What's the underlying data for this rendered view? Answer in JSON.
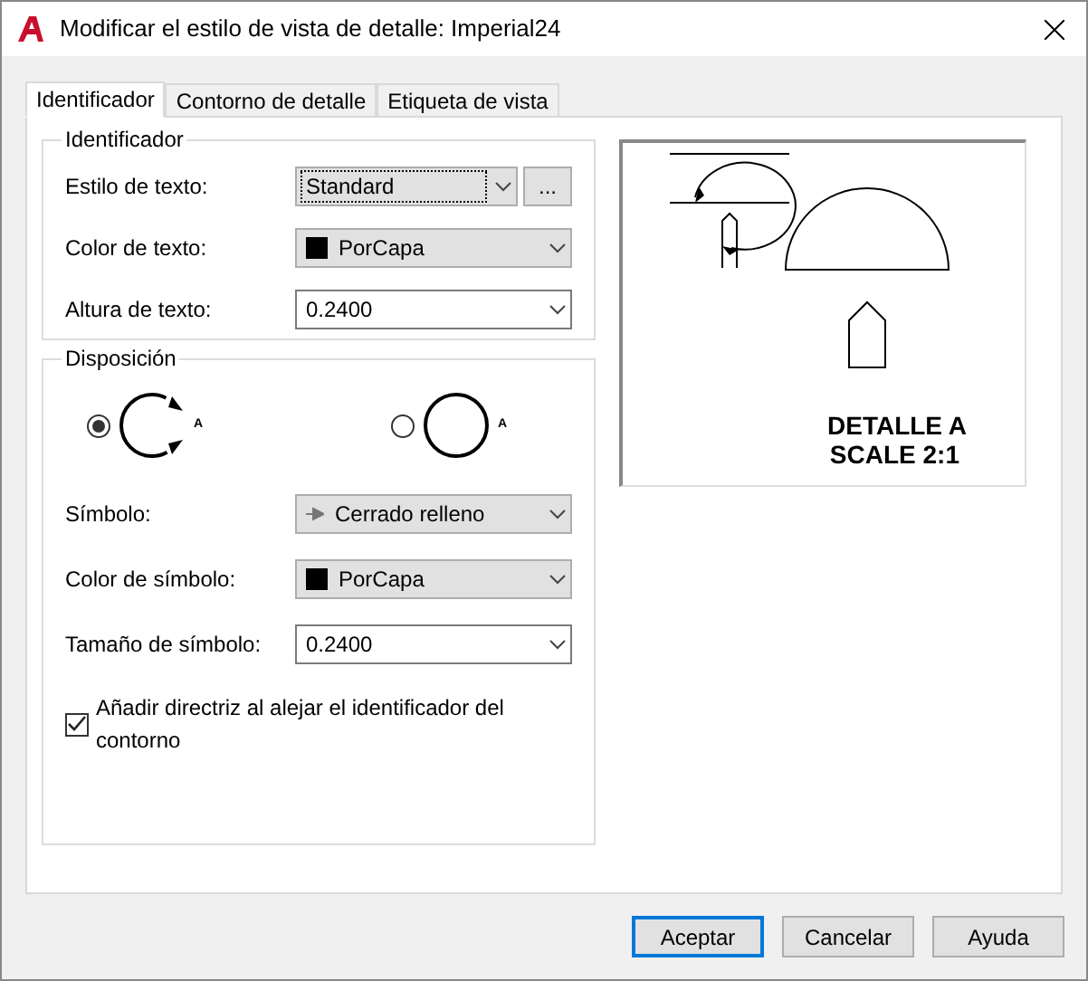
{
  "window": {
    "title": "Modificar el estilo de vista de detalle: Imperial24"
  },
  "tabs": [
    {
      "label": "Identificador",
      "selected": true
    },
    {
      "label": "Contorno de detalle",
      "selected": false
    },
    {
      "label": "Etiqueta de vista",
      "selected": false
    }
  ],
  "identifier_group": {
    "title": "Identificador",
    "fields": [
      {
        "kind": "combo",
        "label": "Estilo de texto:",
        "value": "Standard",
        "focused": true,
        "button": "..."
      },
      {
        "kind": "color",
        "label": "Color de texto:",
        "value": "PorCapa",
        "focused": false
      },
      {
        "kind": "edit",
        "label": "Altura de texto:",
        "value": "0.2400",
        "focused": false
      }
    ]
  },
  "layout_group": {
    "title": "Disposición",
    "options": [
      {
        "selected": true,
        "label": "A"
      },
      {
        "selected": false,
        "label": "A"
      }
    ],
    "fields": [
      {
        "kind": "arrow",
        "label": "Símbolo:",
        "value": "Cerrado relleno",
        "focused": false
      },
      {
        "kind": "color",
        "label": "Color de símbolo:",
        "value": "PorCapa",
        "focused": false
      },
      {
        "kind": "edit",
        "label": "Tamaño de símbolo:",
        "value": "0.2400",
        "focused": false
      }
    ],
    "checkbox": {
      "label": "Añadir directriz al alejar el identificador del contorno",
      "checked": true
    }
  },
  "preview": {
    "lines": [
      "DETALLE A",
      "SCALE 2:1"
    ]
  },
  "buttons": [
    {
      "label": "Aceptar",
      "default": true
    },
    {
      "label": "Cancelar",
      "default": false
    },
    {
      "label": "Ayuda",
      "default": false
    }
  ]
}
